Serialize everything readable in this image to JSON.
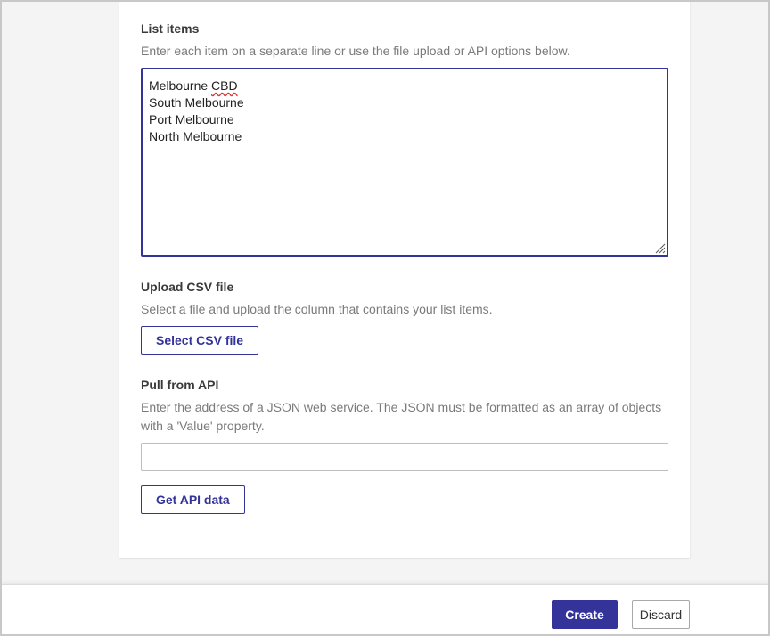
{
  "list_items": {
    "label": "List items",
    "help": "Enter each item on a separate line or use the file upload or API options below.",
    "lines": [
      "Melbourne ",
      "CBD",
      "South Melbourne",
      "Port Melbourne",
      "North Melbourne"
    ]
  },
  "upload_csv": {
    "label": "Upload CSV file",
    "help": "Select a file and upload the column that contains your list items.",
    "button_label": "Select CSV file"
  },
  "pull_api": {
    "label": "Pull from API",
    "help": "Enter the address of a JSON web service. The JSON must be formatted as an array of objects with a 'Value' property.",
    "input_value": "",
    "input_placeholder": "",
    "button_label": "Get API data"
  },
  "footer": {
    "create_label": "Create",
    "discard_label": "Discard"
  },
  "colors": {
    "accent": "#33339a",
    "background": "#f4f4f4",
    "card": "#ffffff"
  },
  "icons": {
    "resize": "resize-grip-icon"
  }
}
